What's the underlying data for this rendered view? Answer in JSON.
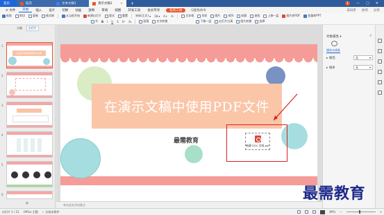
{
  "tabs": {
    "home": "首页",
    "tab1": "稻壳",
    "tab2": "文本文稿1",
    "tab3": "演示文稿1",
    "add": "+",
    "badge": "1"
  },
  "menu": {
    "file": "≡ 文件",
    "items": [
      "开始",
      "插入",
      "设计",
      "切换",
      "动画",
      "放映",
      "审阅",
      "视图",
      "开发工具",
      "会员专享"
    ],
    "active": "开始",
    "pill": "稻壳工具",
    "search": "Q查找命令",
    "right": [
      "未同步",
      "协作",
      "分享"
    ]
  },
  "toolbar": {
    "row1": [
      "粘贴",
      "剪切",
      "复制",
      "格式刷",
      "从当前开始",
      "新建幻灯片",
      "版式",
      "重置",
      "宋体(正文)",
      "18",
      "A+",
      "A-",
      "文本框",
      "形状",
      "图片",
      "排列",
      "轮廓",
      "查找",
      "上移一层",
      "图片转PDF",
      "批量转PPT"
    ],
    "row2": [
      "节",
      "B",
      "I",
      "U",
      "S",
      "X²",
      "X₂",
      "段落",
      "文字转换",
      "下移一层",
      "幻灯片分离",
      "图片转换",
      "选择"
    ]
  },
  "left_panel": {
    "tabs": [
      "大纲",
      "幻灯片"
    ],
    "active_tab": "幻灯片",
    "thumb_title": "在演示文稿中使用PDF文件",
    "numbers": [
      "1",
      "2",
      "3",
      "4",
      "5",
      "6"
    ],
    "add": "+"
  },
  "slide": {
    "title": "在演示文稿中使用PDF文件",
    "subtitle": "最需教育",
    "object_label": "新建 DOC 文档.pdf"
  },
  "right_panel": {
    "title": "对象属性 ▾",
    "close": "× ",
    "tab": "填充与线条",
    "rows": [
      {
        "label": "▸ 填充",
        "value": "无"
      },
      {
        "label": "▸ 线条",
        "value": "无"
      }
    ]
  },
  "notes": "单击此处添加备注",
  "status": {
    "slide": "幻灯片 1 / 21",
    "theme": "Office 主题",
    "protect": "✓ 文档未保护",
    "zoom": "89%"
  },
  "watermark": "最需教育",
  "colors": {
    "accent": "#e8572a",
    "band": "#f59c98",
    "title_band": "#fbc5a8",
    "callout": "#d92020",
    "tab_bar": "#2f5b9a"
  }
}
